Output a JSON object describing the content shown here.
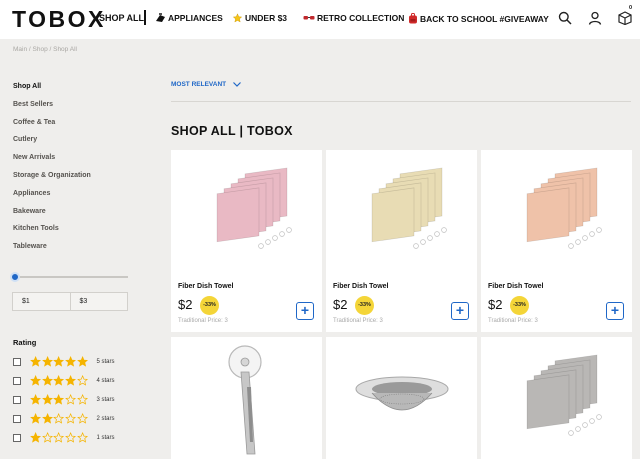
{
  "header": {
    "logo": "TOBOX",
    "shop_all": "SHOP ALL",
    "nav": [
      {
        "label": "APPLIANCES",
        "icon": "appliance-icon"
      },
      {
        "label": "UNDER $3",
        "icon": "star-icon"
      },
      {
        "label": "RETRO COLLECTION",
        "icon": "glasses-icon"
      },
      {
        "label": "BACK TO SCHOOL #GIVEAWAY",
        "icon": "backpack-icon"
      }
    ],
    "cart_count": "0",
    "icons": [
      "search-icon",
      "user-icon",
      "cart-icon"
    ]
  },
  "breadcrumb": "Main / Shop / Shop All",
  "sidebar": {
    "categories": [
      "Shop All",
      "Best Sellers",
      "Coffee & Tea",
      "Cutlery",
      "New Arrivals",
      "Storage & Organization",
      "Appliances",
      "Bakeware",
      "Kitchen Tools",
      "Tableware"
    ],
    "price_min": "$1",
    "price_max": "$3",
    "rating_title": "Rating",
    "ratings": [
      {
        "stars": 5,
        "label": "5 stars"
      },
      {
        "stars": 4,
        "label": "4 stars"
      },
      {
        "stars": 3,
        "label": "3 stars"
      },
      {
        "stars": 2,
        "label": "2 stars"
      },
      {
        "stars": 1,
        "label": "1 stars"
      }
    ]
  },
  "main": {
    "sort_label": "MOST RELEVANT",
    "title": "SHOP ALL | TOBOX",
    "products": [
      {
        "name": "Fiber Dish Towel",
        "price": "$2",
        "discount": "-33%",
        "traditional": "Traditional Price: 3",
        "image": "pink-dish-towels",
        "color": "#e9b9c4"
      },
      {
        "name": "Fiber Dish Towel",
        "price": "$2",
        "discount": "-33%",
        "traditional": "Traditional Price: 3",
        "image": "beige-dish-towels",
        "color": "#e8dcb4"
      },
      {
        "name": "Fiber Dish Towel",
        "price": "$2",
        "discount": "-33%",
        "traditional": "Traditional Price: 3",
        "image": "peach-dish-towels",
        "color": "#efc2a9"
      },
      {
        "image": "pizza-cutter"
      },
      {
        "image": "sink-strainer"
      },
      {
        "image": "grey-dish-towels",
        "color": "#b9b7b5"
      }
    ]
  },
  "colors": {
    "accent": "#1f67c7",
    "badge": "#f4d538",
    "star": "#f5b400",
    "background": "#efeeec"
  }
}
